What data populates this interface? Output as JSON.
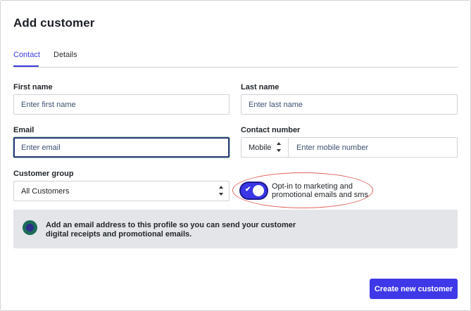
{
  "page": {
    "title": "Add customer"
  },
  "tabs": [
    {
      "label": "Contact",
      "active": true
    },
    {
      "label": "Details",
      "active": false
    }
  ],
  "form": {
    "first_name": {
      "label": "First name",
      "placeholder": "Enter first name",
      "value": ""
    },
    "last_name": {
      "label": "Last name",
      "placeholder": "Enter last name",
      "value": ""
    },
    "email": {
      "label": "Email",
      "placeholder": "Enter email",
      "value": "",
      "focused": true
    },
    "contact_number": {
      "label": "Contact number",
      "type_value": "Mobile",
      "placeholder": "Enter mobile number",
      "value": ""
    },
    "customer_group": {
      "label": "Customer group",
      "selected": "All Customers"
    },
    "opt_in": {
      "label": "Opt-in to marketing and promotional emails and sms",
      "enabled": true
    }
  },
  "info_banner": {
    "text": "Add an email address to this profile so you can send your customer digital receipts and promotional emails."
  },
  "actions": {
    "create_label": "Create new customer"
  },
  "colors": {
    "accent": "#3f38e8",
    "focus_border": "#2d3b7a",
    "banner_bg": "#e3e5e9",
    "annotation": "#e0635a"
  },
  "icons": {
    "opt_in_check": "check-icon",
    "info": "info-circle-icon",
    "stepper": "up-down-chevron-icon"
  }
}
